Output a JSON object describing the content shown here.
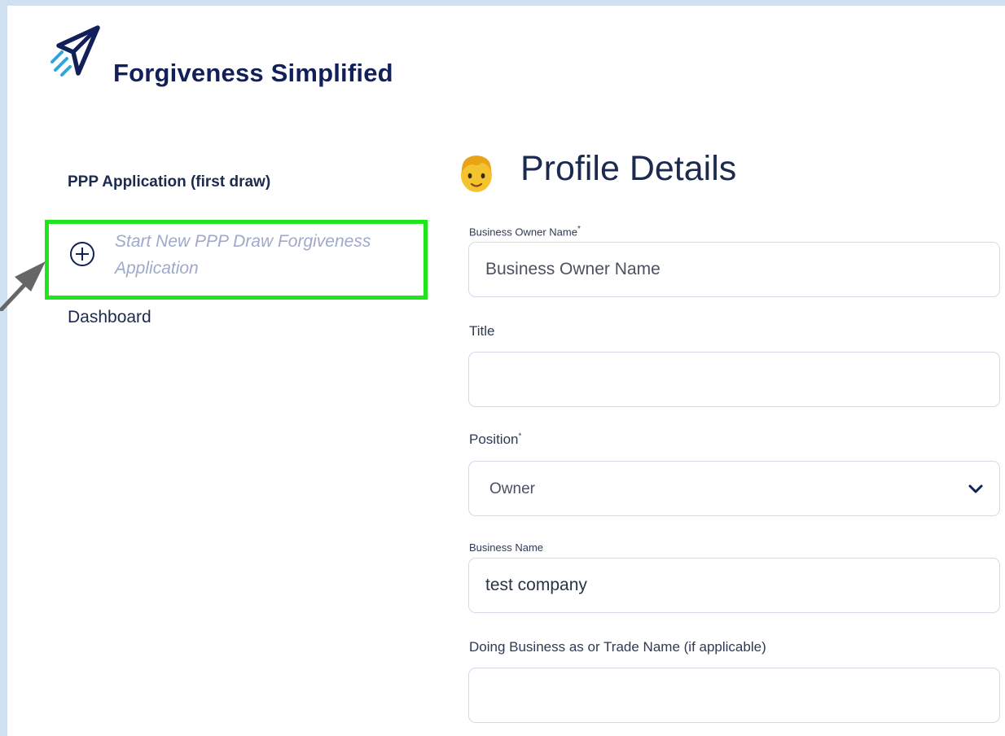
{
  "brand": {
    "name": "Forgiveness Simplified",
    "logo_icon": "paper-plane-icon",
    "logo_colors": [
      "#12205a",
      "#29a8df"
    ]
  },
  "sidebar": {
    "heading": "PPP Application (first draw)",
    "new_application": {
      "icon": "plus-circle-icon",
      "label": "Start New PPP Draw Forgiveness Application"
    },
    "dashboard_label": "Dashboard"
  },
  "main": {
    "title_icon": "person-emoji-icon",
    "title": "Profile Details",
    "fields": {
      "business_owner_name": {
        "label": "Business Owner Name",
        "required_mark": "*",
        "placeholder": "Business Owner Name",
        "value": ""
      },
      "title": {
        "label": "Title",
        "placeholder": "",
        "value": ""
      },
      "position": {
        "label": "Position",
        "required_mark": "*",
        "selected": "Owner"
      },
      "business_name": {
        "label": "Business Name",
        "value": "test company"
      },
      "dba": {
        "label": "Doing Business as or Trade Name (if applicable)",
        "value": ""
      }
    }
  },
  "annotation": {
    "highlight_color": "#1fe51b",
    "arrow_color": "#666666"
  },
  "colors": {
    "background": "#cfe1f1",
    "primary_text": "#1b2a4e",
    "muted_text": "#9fa9c9",
    "field_border": "#d3d9e6"
  }
}
